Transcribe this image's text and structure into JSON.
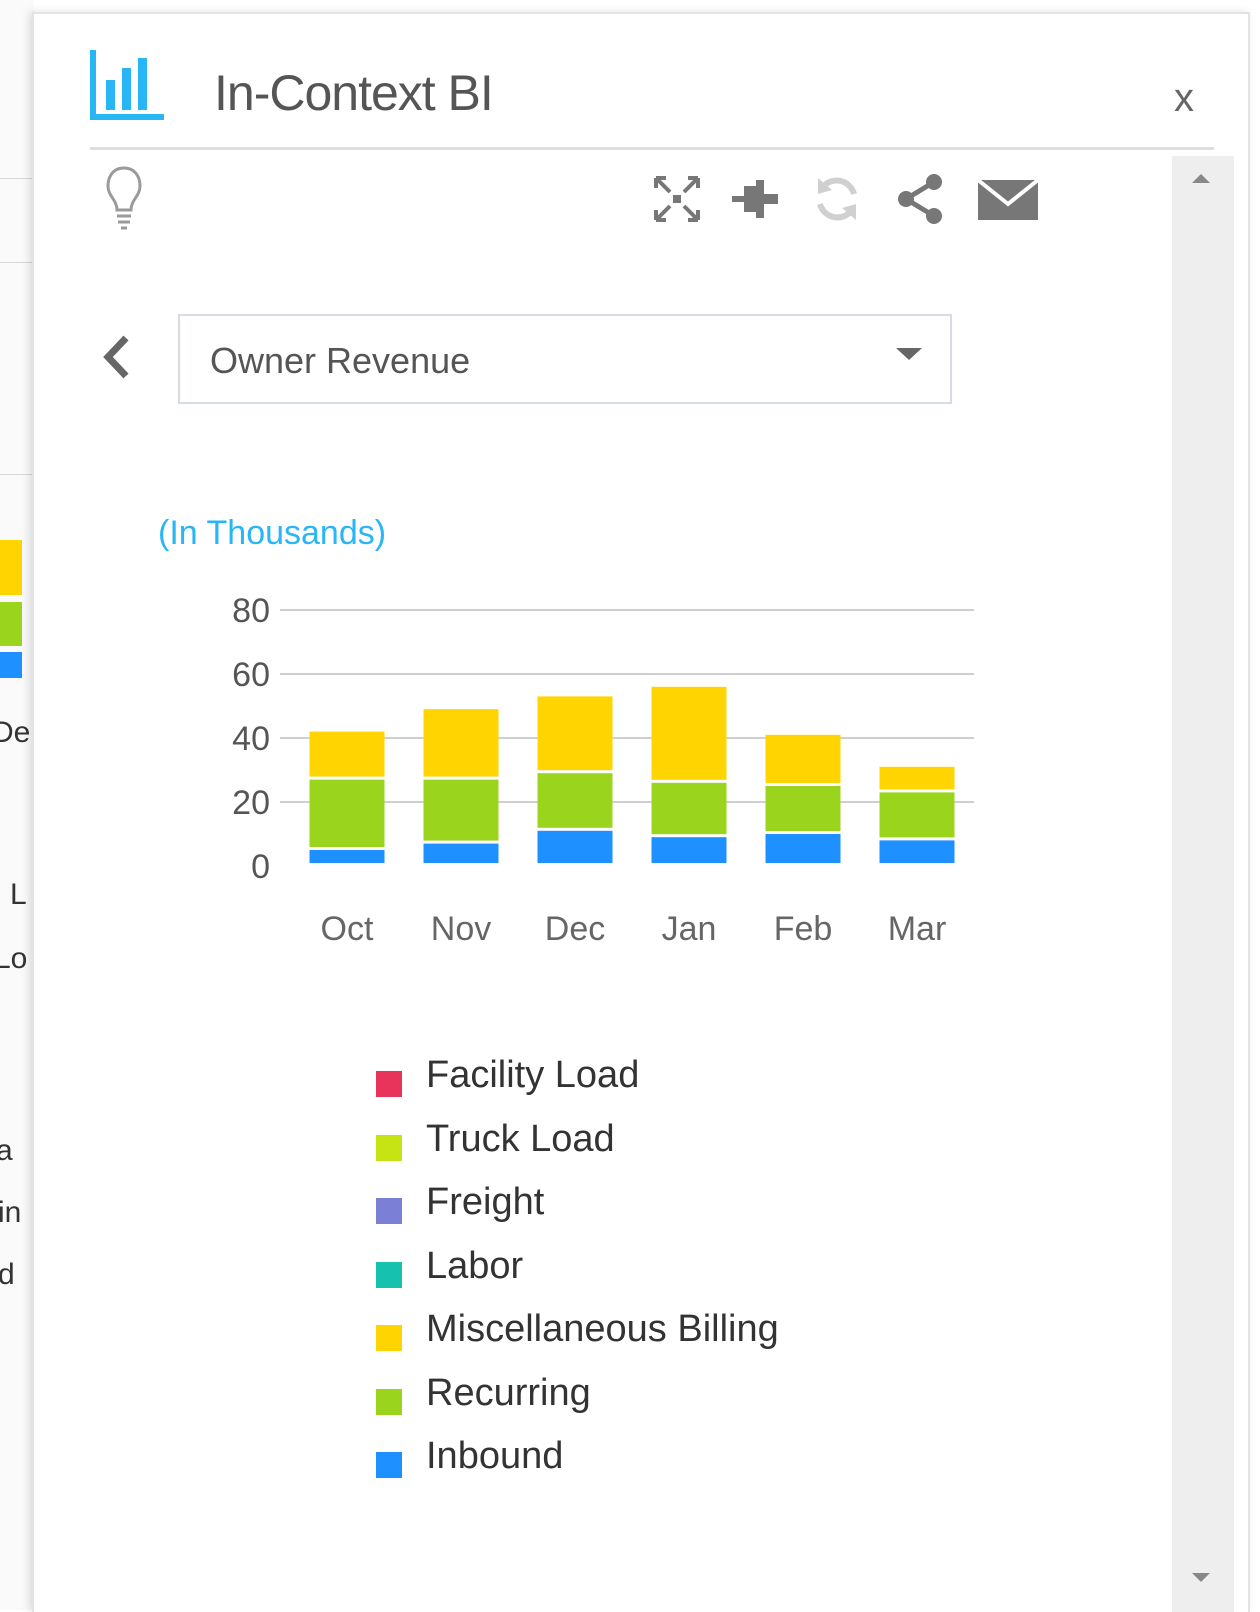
{
  "background_app": {
    "fragments": [
      "De",
      "L",
      "Lo",
      "a",
      "in",
      "d"
    ]
  },
  "panel": {
    "title": "In-Context BI",
    "close_label": "x",
    "icons": {
      "logo": "bar-chart-icon",
      "tip": "lightbulb-icon",
      "expand": "expand-icon",
      "pin": "pin-icon",
      "refresh": "refresh-icon",
      "share": "share-icon",
      "email": "mail-icon",
      "back": "chevron-left-icon"
    },
    "report_select": {
      "value": "Owner Revenue"
    },
    "colors": {
      "accent": "#29b6f6",
      "title": "#555555"
    }
  },
  "chart_data": {
    "type": "bar",
    "stacked": true,
    "unit_label": "(In Thousands)",
    "categories": [
      "Oct",
      "Nov",
      "Dec",
      "Jan",
      "Feb",
      "Mar"
    ],
    "ylim": [
      0,
      80
    ],
    "yticks": [
      "0",
      "20",
      "40",
      "60",
      "80"
    ],
    "grid": true,
    "series": [
      {
        "name": "Inbound",
        "color": "#1e90ff",
        "values": [
          5,
          7,
          11,
          9,
          10,
          8
        ]
      },
      {
        "name": "Recurring",
        "color": "#9ad41c",
        "values": [
          22,
          20,
          18,
          17,
          15,
          15
        ]
      },
      {
        "name": "Miscellaneous Billing",
        "color": "#ffd400",
        "values": [
          15,
          22,
          24,
          30,
          16,
          8
        ]
      }
    ],
    "legend_position": "bottom",
    "legend": [
      {
        "name": "Facility Load",
        "color": "#e8345a"
      },
      {
        "name": "Truck Load",
        "color": "#c6e314"
      },
      {
        "name": "Freight",
        "color": "#7b7fd6"
      },
      {
        "name": "Labor",
        "color": "#17c1b0"
      },
      {
        "name": "Miscellaneous Billing",
        "color": "#ffd400"
      },
      {
        "name": "Recurring",
        "color": "#9ad41c"
      },
      {
        "name": "Inbound",
        "color": "#1e90ff"
      }
    ]
  }
}
